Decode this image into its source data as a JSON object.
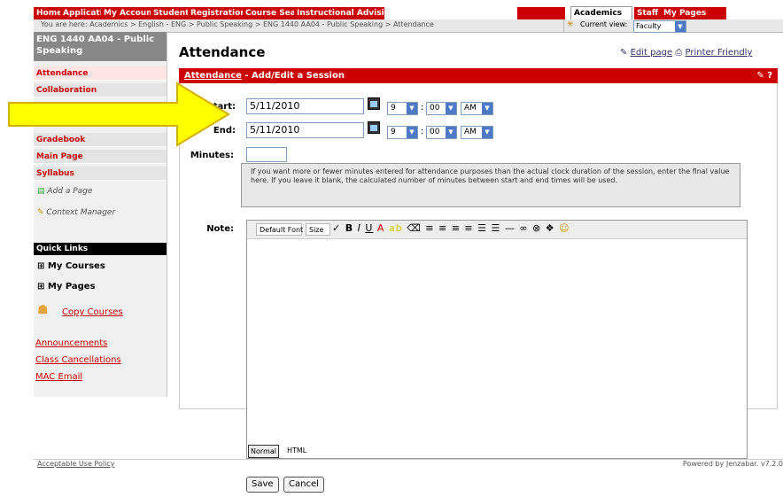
{
  "top_tabs": [
    "Home",
    "Applications",
    "My Account Info",
    "Student",
    "Registration",
    "Course Search",
    "Instructional Advising",
    "",
    "Academics",
    "Staff",
    "My Pages"
  ],
  "breadcrumb": "You are here:  Academics > English - ENG > Public Speaking > ENG 1440 AA04 - Public Speaking > Attendance",
  "current_view": {
    "label": "Current view:",
    "value": "Faculty"
  },
  "sidebar": {
    "course_title": "ENG 1440 AA04 - Public Speaking",
    "nav": [
      "Attendance",
      "Collaboration",
      "Gradebook",
      "Main Page",
      "Syllabus"
    ],
    "tools": [
      "Add a Page",
      "Context Manager"
    ],
    "quick_links_heading": "Quick Links",
    "quick_links": [
      "My Courses",
      "My Pages"
    ],
    "copy_courses": "Copy Courses",
    "links": [
      "Announcements",
      "Class Cancellations",
      "MAC Email"
    ]
  },
  "page_title": "Attendance",
  "edit_page": "Edit page",
  "printer_friendly": "Printer Friendly",
  "section_header": {
    "link": "Attendance",
    "rest": " - Add/Edit a Session"
  },
  "form": {
    "start_label": "Start:",
    "start_date": "5/11/2010",
    "start_hour": "9",
    "start_minute": "00",
    "start_ampm": "AM",
    "end_label": "End:",
    "end_date": "5/11/2010",
    "end_hour": "9",
    "end_minute": "00",
    "end_ampm": "AM",
    "minutes_label": "Minutes:",
    "help_text": "If you want more or fewer minutes entered for attendance purposes than the actual clock duration of the session, enter the final value here. If you leave it blank, the calculated number of minutes between start and end times will be used.",
    "note_label": "Note:",
    "font_select": "Default Font",
    "size_select": "Size",
    "mode_normal": "Normal",
    "mode_html": "HTML"
  },
  "footer": {
    "left": "Acceptable Use Policy",
    "right": "Powered by Jenzabar. v7.2.0"
  },
  "buttons": {
    "save": "Save",
    "cancel": "Cancel"
  },
  "colors": {
    "brand_red": "#cc0000",
    "arrow_fill": "#ffff00"
  }
}
